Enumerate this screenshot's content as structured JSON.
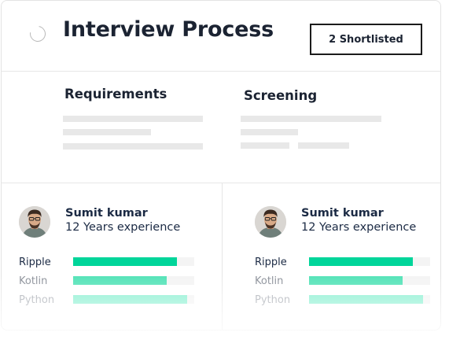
{
  "header": {
    "title": "Interview Process",
    "shortlisted_label": "2 Shortlisted"
  },
  "sections": [
    {
      "title": "Requirements"
    },
    {
      "title": "Screening"
    }
  ],
  "candidates": [
    {
      "name": "Sumit kumar",
      "experience": "12 Years experience",
      "skills": [
        {
          "label": "Ripple",
          "level": 0.86,
          "color": "#00d59a",
          "label_color": "#1b2a44"
        },
        {
          "label": "Kotlin",
          "level": 0.77,
          "color": "#55e3b8",
          "label_color": "#8a8f98"
        },
        {
          "label": "Python",
          "level": 0.94,
          "color": "#8cf0d2",
          "label_color": "#a9adb4"
        }
      ]
    },
    {
      "name": "Sumit kumar",
      "experience": "12 Years experience",
      "skills": [
        {
          "label": "Ripple",
          "level": 0.86,
          "color": "#00d59a",
          "label_color": "#1b2a44"
        },
        {
          "label": "Kotlin",
          "level": 0.77,
          "color": "#55e3b8",
          "label_color": "#8a8f98"
        },
        {
          "label": "Python",
          "level": 0.94,
          "color": "#8cf0d2",
          "label_color": "#a9adb4"
        }
      ]
    }
  ],
  "colors": {
    "accent": "#00d59a",
    "text_dark": "#1b2332",
    "skeleton": "#e8e8e8"
  },
  "icons": {
    "loading": "spinner-icon",
    "avatar": "avatar-photo"
  }
}
